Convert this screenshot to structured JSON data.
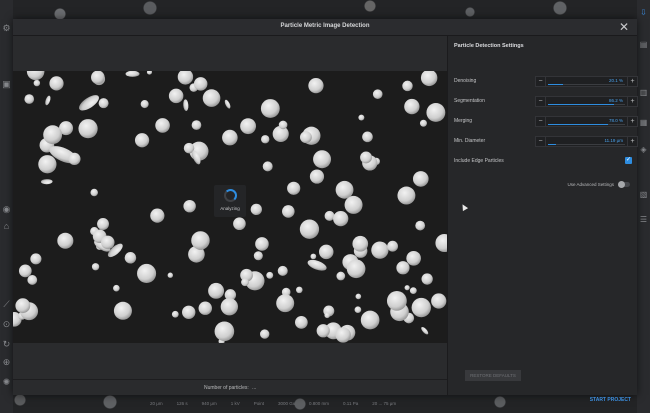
{
  "modal": {
    "title": "Particle Metric Image Detection",
    "close_icon": "close-icon"
  },
  "image": {
    "status_label": "Analyzing",
    "particle_count_label": "Number of particles:",
    "particle_count_value": "..."
  },
  "settings": {
    "title": "Particle Detection Settings",
    "rows": [
      {
        "label": "Denoising",
        "value": "20.1 %",
        "fraction": 0.201
      },
      {
        "label": "Segmentation",
        "value": "86.2 %",
        "fraction": 0.862
      },
      {
        "label": "Merging",
        "value": "78.0 %",
        "fraction": 0.78
      },
      {
        "label": "Min. Diameter",
        "value": "11.19 μm",
        "fraction": 0.1
      }
    ],
    "include_edge_label": "Include Edge Particles",
    "include_edge_checked": true,
    "advanced_label": "Use Advanced Settings",
    "advanced_on": false,
    "reset_label": "RESTORE DEFAULTS",
    "start_label": "START PROJECT"
  },
  "background": {
    "bottom_bar": [
      "20 μm",
      "126 s",
      "940 μm",
      "1 kV",
      "Point",
      "3000 Gx",
      "0.800 mm",
      "0.11 Pa",
      "20 ... 75 μm"
    ]
  },
  "colors": {
    "accent": "#2e8de0",
    "particle": "#cfcfcf",
    "background": "#1c1c1c"
  }
}
